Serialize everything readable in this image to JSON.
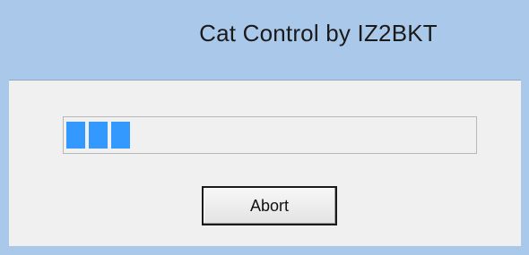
{
  "window": {
    "title": "Cat Control by IZ2BKT"
  },
  "dialog": {
    "status_text": "",
    "progress": {
      "filled_blocks": 3,
      "fill_color": "#3399ff"
    },
    "abort_label": "Abort"
  },
  "colors": {
    "frame": "#aac9ea",
    "client_background": "#f0f0f0"
  }
}
